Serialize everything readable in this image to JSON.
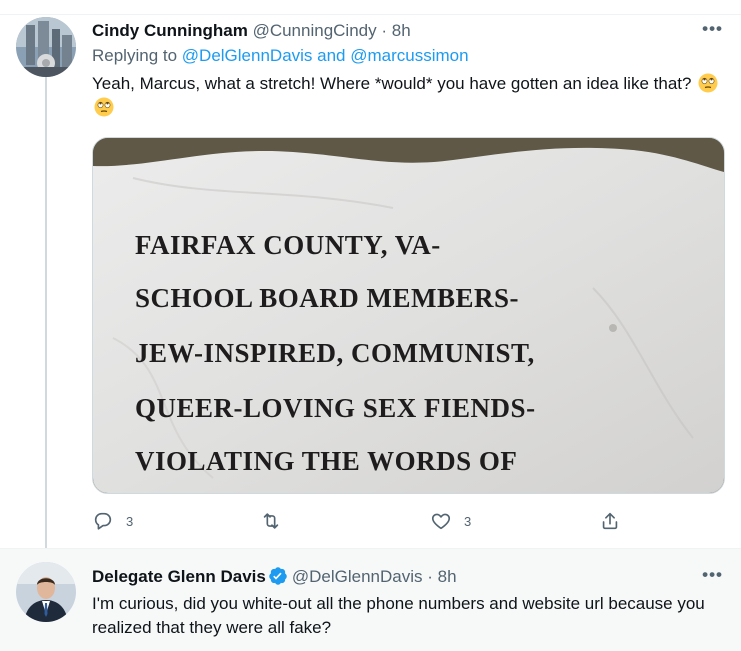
{
  "tweet1": {
    "name": "Cindy Cunningham",
    "handle": "@CunningCindy",
    "dot": "·",
    "time": "8h",
    "replying_prefix": "Replying to ",
    "replying_mentions": "@DelGlennDavis and @marcussimon",
    "text": "Yeah, Marcus, what a stretch! Where *would* you have gotten an idea like that?",
    "emojis": [
      "face-with-rolling-eyes",
      "face-with-rolling-eyes"
    ],
    "image_text": [
      "FAIRFAX COUNTY, VA-",
      "SCHOOL BOARD MEMBERS-",
      "JEW-INSPIRED, COMMUNIST,",
      "QUEER-LOVING SEX FIENDS-",
      "VIOLATING THE WORDS OF"
    ],
    "more_label": "•••",
    "actions": {
      "reply_count": "3",
      "retweet_count": "",
      "like_count": "3"
    }
  },
  "tweet2": {
    "name": "Delegate Glenn Davis",
    "verified": true,
    "handle": "@DelGlennDavis",
    "dot": "·",
    "time": "8h",
    "text": "I'm curious, did you white-out all the phone numbers and website url because you realized that they were all fake?",
    "more_label": "•••"
  },
  "colors": {
    "link": "#1d9bf0",
    "secondary_text": "#536471",
    "thread_line": "#cfd9de",
    "reply_bg": "#f7f9f9"
  },
  "icons": [
    "reply-icon",
    "retweet-icon",
    "like-icon",
    "share-icon",
    "verified-badge-icon",
    "more-icon"
  ]
}
